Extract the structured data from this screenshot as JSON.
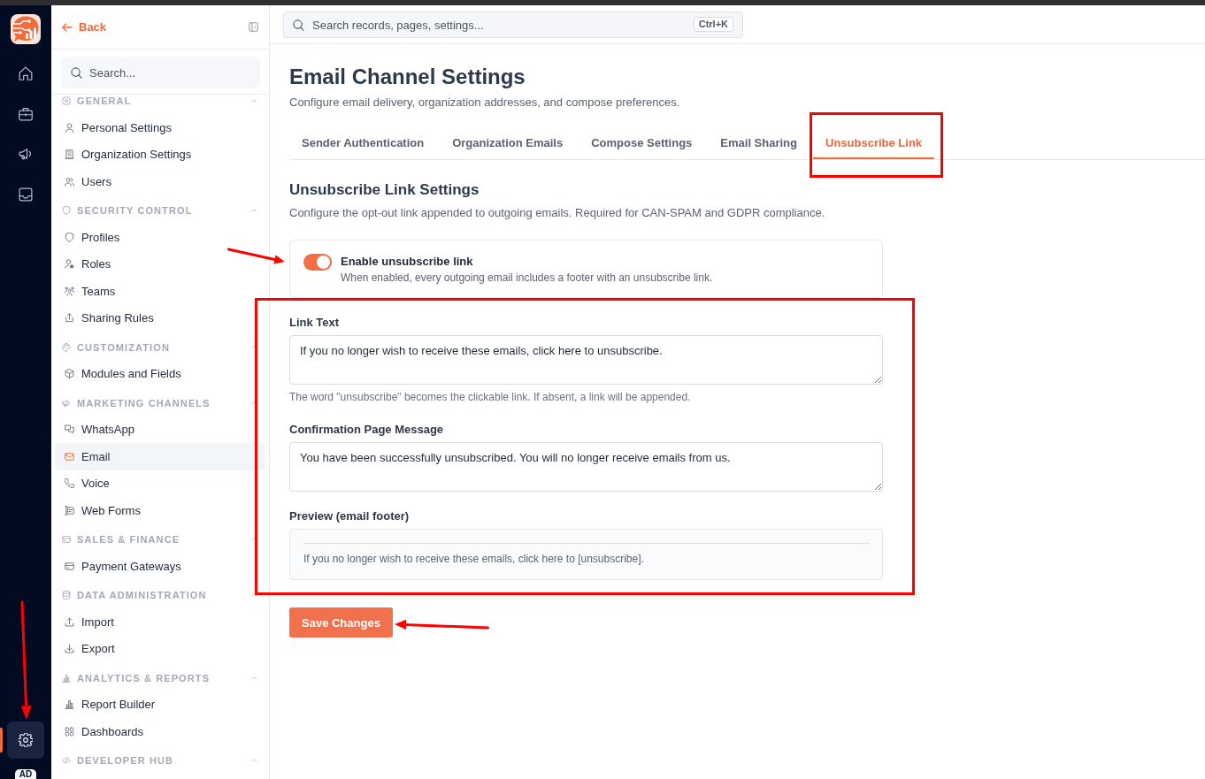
{
  "rail": {
    "items": [
      {
        "selected": false
      },
      {
        "selected": false
      },
      {
        "selected": false
      },
      {
        "selected": false
      },
      {
        "selected": true,
        "pointed_at": true
      }
    ],
    "avatar": "AD"
  },
  "sidebar": {
    "back_link": "Back",
    "search": {
      "placeholder": "Search..."
    },
    "sections": [
      {
        "title": "GENERAL",
        "expanded": true,
        "items": [
          {
            "label": "Personal Settings",
            "selected": false
          },
          {
            "label": "Organization Settings",
            "selected": false
          },
          {
            "label": "Users",
            "selected": false
          }
        ]
      },
      {
        "title": "SECURITY CONTROL",
        "expanded": true,
        "items": [
          {
            "label": "Profiles",
            "selected": false
          },
          {
            "label": "Roles",
            "selected": false
          },
          {
            "label": "Teams",
            "selected": false
          },
          {
            "label": "Sharing Rules",
            "selected": false
          }
        ]
      },
      {
        "title": "CUSTOMIZATION",
        "expanded": true,
        "items": [
          {
            "label": "Modules and Fields",
            "selected": false
          }
        ]
      },
      {
        "title": "MARKETING CHANNELS",
        "expanded": true,
        "items": [
          {
            "label": "WhatsApp",
            "selected": false
          },
          {
            "label": "Email",
            "selected": true
          },
          {
            "label": "Voice",
            "selected": false
          },
          {
            "label": "Web Forms",
            "selected": false
          }
        ]
      },
      {
        "title": "SALES & FINANCE",
        "expanded": true,
        "items": [
          {
            "label": "Payment Gateways",
            "selected": false
          }
        ]
      },
      {
        "title": "DATA ADMINISTRATION",
        "expanded": true,
        "items": [
          {
            "label": "Import",
            "selected": false
          },
          {
            "label": "Export",
            "selected": false
          }
        ]
      },
      {
        "title": "ANALYTICS & REPORTS",
        "expanded": true,
        "items": [
          {
            "label": "Report Builder",
            "selected": false
          },
          {
            "label": "Dashboards",
            "selected": false
          }
        ]
      },
      {
        "title": "DEVELOPER HUB",
        "expanded": true
      }
    ]
  },
  "topbar": {
    "search": {
      "placeholder": "Search records, pages, settings...",
      "shortcut": "Ctrl+K"
    }
  },
  "page": {
    "title": "Email Channel Settings",
    "subtitle": "Configure email delivery, organization addresses, and compose preferences.",
    "tabs": [
      {
        "label": "Sender Authentication",
        "selected": false
      },
      {
        "label": "Organization Emails",
        "selected": false
      },
      {
        "label": "Compose Settings",
        "selected": false
      },
      {
        "label": "Email Sharing",
        "selected": false
      },
      {
        "label": "Unsubscribe Link",
        "selected": true,
        "outlined": true
      }
    ],
    "panel": {
      "title": "Unsubscribe Link Settings",
      "description": "Configure the opt-out link appended to outgoing emails. Required for CAN-SPAM and GDPR compliance.",
      "toggle": {
        "label": "Enable unsubscribe link",
        "description": "When enabled, every outgoing email includes a footer with an unsubscribe link.",
        "on": true,
        "pointed_at": true
      },
      "fields": {
        "outlined": true,
        "items": [
          {
            "kind": "textarea",
            "label": "Link Text",
            "value": "If you no longer wish to receive these emails, click here to unsubscribe.",
            "help": "The word \"unsubscribe\" becomes the clickable link. If absent, a link will be appended."
          },
          {
            "kind": "textarea",
            "label": "Confirmation Page Message",
            "value": "You have been successfully unsubscribed. You will no longer receive emails from us."
          },
          {
            "kind": "preview",
            "label": "Preview (email footer)",
            "text": "If you no longer wish to receive these emails, click here to [unsubscribe]."
          }
        ]
      },
      "save_button": {
        "label": "Save Changes",
        "pointed_at": true
      }
    }
  }
}
